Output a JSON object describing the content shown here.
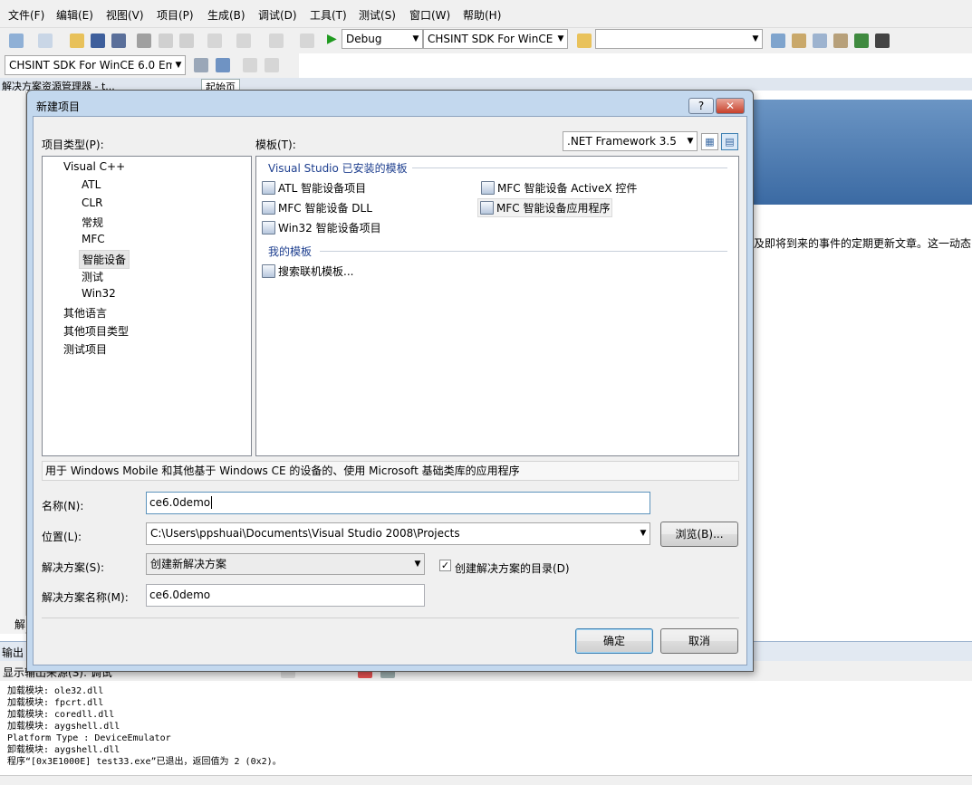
{
  "menu": [
    "文件(F)",
    "编辑(E)",
    "视图(V)",
    "项目(P)",
    "生成(B)",
    "调试(D)",
    "工具(T)",
    "测试(S)",
    "窗口(W)",
    "帮助(H)"
  ],
  "toolbar": {
    "config": "Debug",
    "platform": "CHSINT SDK For WinCE",
    "search": "",
    "device": "CHSINT SDK For WinCE 6.0 Em"
  },
  "background": {
    "solution_explorer_tab": "解决方案资源管理器 - t...",
    "start_page_tab": "起始页",
    "news_text": "及即将到来的事件的定期更新文章。这一动态",
    "solution_panel_tab": "解",
    "output_title": "输出",
    "output_source_label": "显示输出来源(S): 调试",
    "output_lines": [
      "加载模块: ole32.dll",
      "加载模块: fpcrt.dll",
      "加载模块: coredll.dll",
      "加载模块: aygshell.dll",
      "Platform Type : DeviceEmulator",
      "卸载模块: aygshell.dll",
      "程序“[0x3E1000E] test33.exe”已退出，返回值为 2 (0x2)。"
    ]
  },
  "dialog": {
    "title": "新建项目",
    "help_button": "?",
    "close_button": "✕",
    "project_types_label": "项目类型(P):",
    "templates_label": "模板(T):",
    "framework": ".NET Framework 3.5",
    "project_types": [
      {
        "label": "Visual C++",
        "level": 0
      },
      {
        "label": "ATL",
        "level": 1
      },
      {
        "label": "CLR",
        "level": 1
      },
      {
        "label": "常规",
        "level": 1
      },
      {
        "label": "MFC",
        "level": 1
      },
      {
        "label": "智能设备",
        "level": 1,
        "selected": true
      },
      {
        "label": "测试",
        "level": 1
      },
      {
        "label": "Win32",
        "level": 1
      },
      {
        "label": "其他语言",
        "level": 0
      },
      {
        "label": "其他项目类型",
        "level": 0
      },
      {
        "label": "测试项目",
        "level": 0
      }
    ],
    "installed_group": "Visual Studio 已安装的模板",
    "templates": [
      "ATL 智能设备项目",
      "MFC 智能设备 ActiveX 控件",
      "MFC 智能设备 DLL",
      "MFC 智能设备应用程序",
      "Win32 智能设备项目"
    ],
    "my_templates_group": "我的模板",
    "my_templates": [
      "搜索联机模板..."
    ],
    "description": "用于 Windows Mobile 和其他基于 Windows CE 的设备的、使用 Microsoft 基础类库的应用程序",
    "name_label": "名称(N):",
    "name_value": "ce6.0demo",
    "location_label": "位置(L):",
    "location_value": "C:\\Users\\ppshuai\\Documents\\Visual Studio 2008\\Projects",
    "browse_button": "浏览(B)...",
    "solution_label": "解决方案(S):",
    "solution_value": "创建新解决方案",
    "create_dir_label": "创建解决方案的目录(D)",
    "create_dir_checked": true,
    "solution_name_label": "解决方案名称(M):",
    "solution_name_value": "ce6.0demo",
    "ok_button": "确定",
    "cancel_button": "取消"
  }
}
